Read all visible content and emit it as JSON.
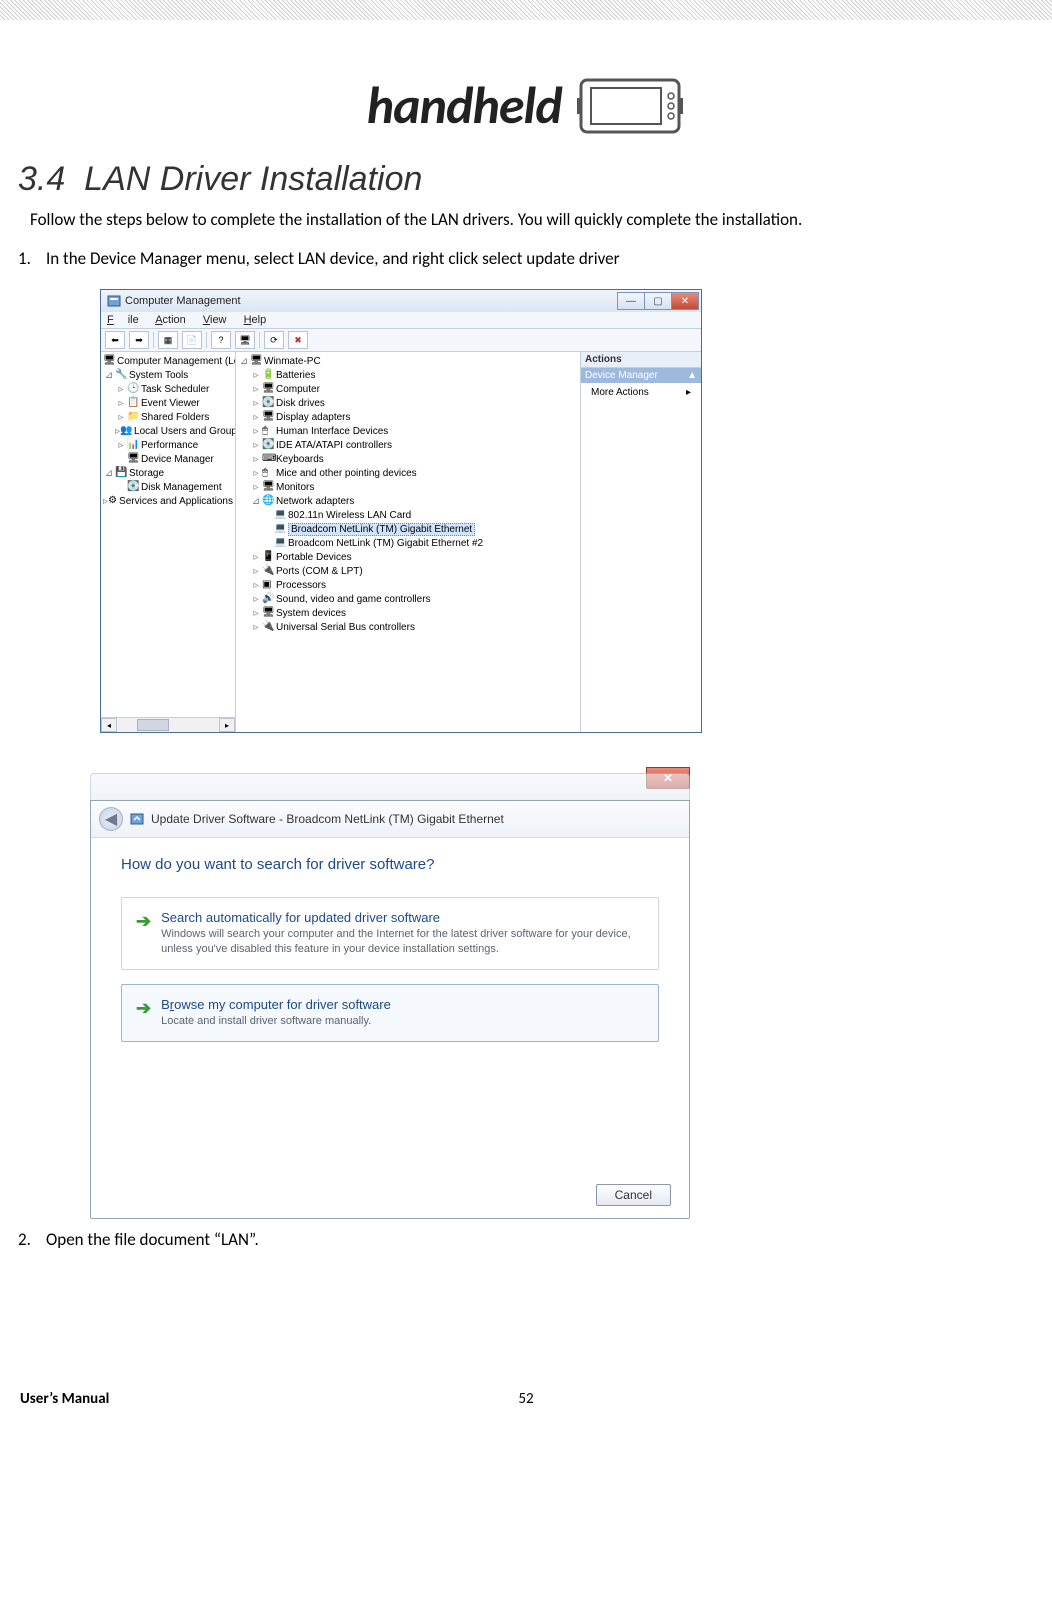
{
  "logo_text": "handheld",
  "section_number": "3.4",
  "section_title": "LAN Driver Installation",
  "intro": "Follow the steps below to complete the installation of the LAN drivers. You will quickly complete the installation.",
  "step1": "In the Device Manager menu, select LAN device, and right click select update driver",
  "step2": "Open the file document “LAN”.",
  "footer_left": "User’s Manual",
  "footer_center": "52",
  "cm": {
    "title": "Computer Management",
    "menu": {
      "file": "File",
      "action": "Action",
      "view": "View",
      "help": "Help"
    },
    "left_root": "Computer Management (Local",
    "system_tools": "System Tools",
    "task_sched": "Task Scheduler",
    "event_viewer": "Event Viewer",
    "shared": "Shared Folders",
    "local_users": "Local Users and Groups",
    "performance": "Performance",
    "devmgr": "Device Manager",
    "storage": "Storage",
    "disk_mgmt": "Disk Management",
    "services": "Services and Applications",
    "mach": "Winmate-PC",
    "cat_batteries": "Batteries",
    "cat_computer": "Computer",
    "cat_disk": "Disk drives",
    "cat_display": "Display adapters",
    "cat_hid": "Human Interface Devices",
    "cat_ide": "IDE ATA/ATAPI controllers",
    "cat_kbd": "Keyboards",
    "cat_mice": "Mice and other pointing devices",
    "cat_mon": "Monitors",
    "cat_net": "Network adapters",
    "net_wlan": "802.11n Wireless LAN Card",
    "net_bcm1": "Broadcom NetLink (TM) Gigabit Ethernet",
    "net_bcm2": "Broadcom NetLink (TM) Gigabit Ethernet #2",
    "cat_portable": "Portable Devices",
    "cat_ports": "Ports (COM & LPT)",
    "cat_proc": "Processors",
    "cat_sound": "Sound, video and game controllers",
    "cat_sysdev": "System devices",
    "cat_usb": "Universal Serial Bus controllers",
    "actions_hdr": "Actions",
    "actions_sub": "Device Manager",
    "actions_more": "More Actions"
  },
  "dlg": {
    "title": "Update Driver Software - Broadcom NetLink (TM) Gigabit Ethernet",
    "question": "How do you want to search for driver software?",
    "opt1_title": "Search automatically for updated driver software",
    "opt1_desc": "Windows will search your computer and the Internet for the latest driver software for your device, unless you've disabled this feature in your device installation settings.",
    "opt2_title": "Browse my computer for driver software",
    "opt2_desc": "Locate and install driver software manually.",
    "cancel": "Cancel"
  }
}
